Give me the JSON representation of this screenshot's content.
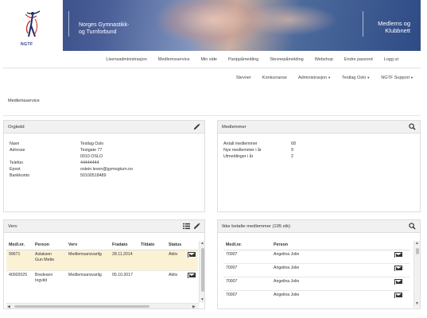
{
  "header": {
    "logo_text": "NGTF",
    "org_name_line1": "Norges Gymnastikk-",
    "org_name_line2": "og Turnforbund",
    "app_name_line1": "Medlems og",
    "app_name_line2": "Klubbnett"
  },
  "nav_row1": [
    "Lisensadministrasjon",
    "Medlemsservice",
    "Min side",
    "Parippåmelding",
    "Stevnepåmelding",
    "Webshop",
    "Endre passord",
    "Logg ut"
  ],
  "nav_row2": [
    {
      "label": "Stevner",
      "dropdown": false
    },
    {
      "label": "Konkurranse",
      "dropdown": false
    },
    {
      "label": "Administrasjon",
      "dropdown": true
    },
    {
      "label": "Testlag Oslo",
      "dropdown": true
    },
    {
      "label": "NGTF Support",
      "dropdown": true
    }
  ],
  "breadcrumb": "Medlemsservice",
  "orgledd": {
    "title": "Orgledd",
    "rows": [
      {
        "key": "Navn",
        "value": "Testlag Oslo"
      },
      {
        "key": "Adresse",
        "value": "Testgate 77"
      },
      {
        "key": "",
        "value": "0010 OSLO"
      },
      {
        "key": "Telefon",
        "value": "44444444"
      },
      {
        "key": "Epost",
        "value": "ostein.leven@gymogturn.no"
      },
      {
        "key": "Bankkonto",
        "value": "50100518489"
      }
    ]
  },
  "medlemmer": {
    "title": "Medlemmer",
    "rows": [
      {
        "key": "Antall medlemmer",
        "value": "68"
      },
      {
        "key": "Nye medlemmer i år",
        "value": "9"
      },
      {
        "key": "Utmeldinger i år",
        "value": "2"
      }
    ]
  },
  "verv": {
    "title": "Verv",
    "columns": [
      "Medl.nr.",
      "Person",
      "Verv",
      "Fradato",
      "Tildato",
      "Status"
    ],
    "rows": [
      {
        "nr": "99671",
        "person_line1": "Aslaksen",
        "person_line2": "Gun Mette",
        "verv": "Medlemsansvarlig",
        "fra": "28.11.2014",
        "til": "",
        "status": "Aktiv",
        "highlight": true
      },
      {
        "nr": "40002025",
        "person_line1": "Bredesen",
        "person_line2": "Ingvild",
        "verv": "Medlemsansvarlig",
        "fra": "05.10.2017",
        "til": "",
        "status": "Aktiv",
        "highlight": false
      }
    ]
  },
  "ikke_betalte": {
    "title": "Ikke betalte medlemmer (195 stk)",
    "columns": [
      "Medl.nr.",
      "Person"
    ],
    "rows": [
      {
        "nr": "70007",
        "person": "Angelina Jolie"
      },
      {
        "nr": "70007",
        "person": "Angelina Jolie"
      },
      {
        "nr": "70007",
        "person": "Angelina Jolie"
      },
      {
        "nr": "70007",
        "person": "Angelina Jolie"
      }
    ]
  },
  "icons": {
    "edit": "pencil-icon",
    "search": "search-icon",
    "list": "list-icon",
    "mail": "envelope-icon"
  }
}
